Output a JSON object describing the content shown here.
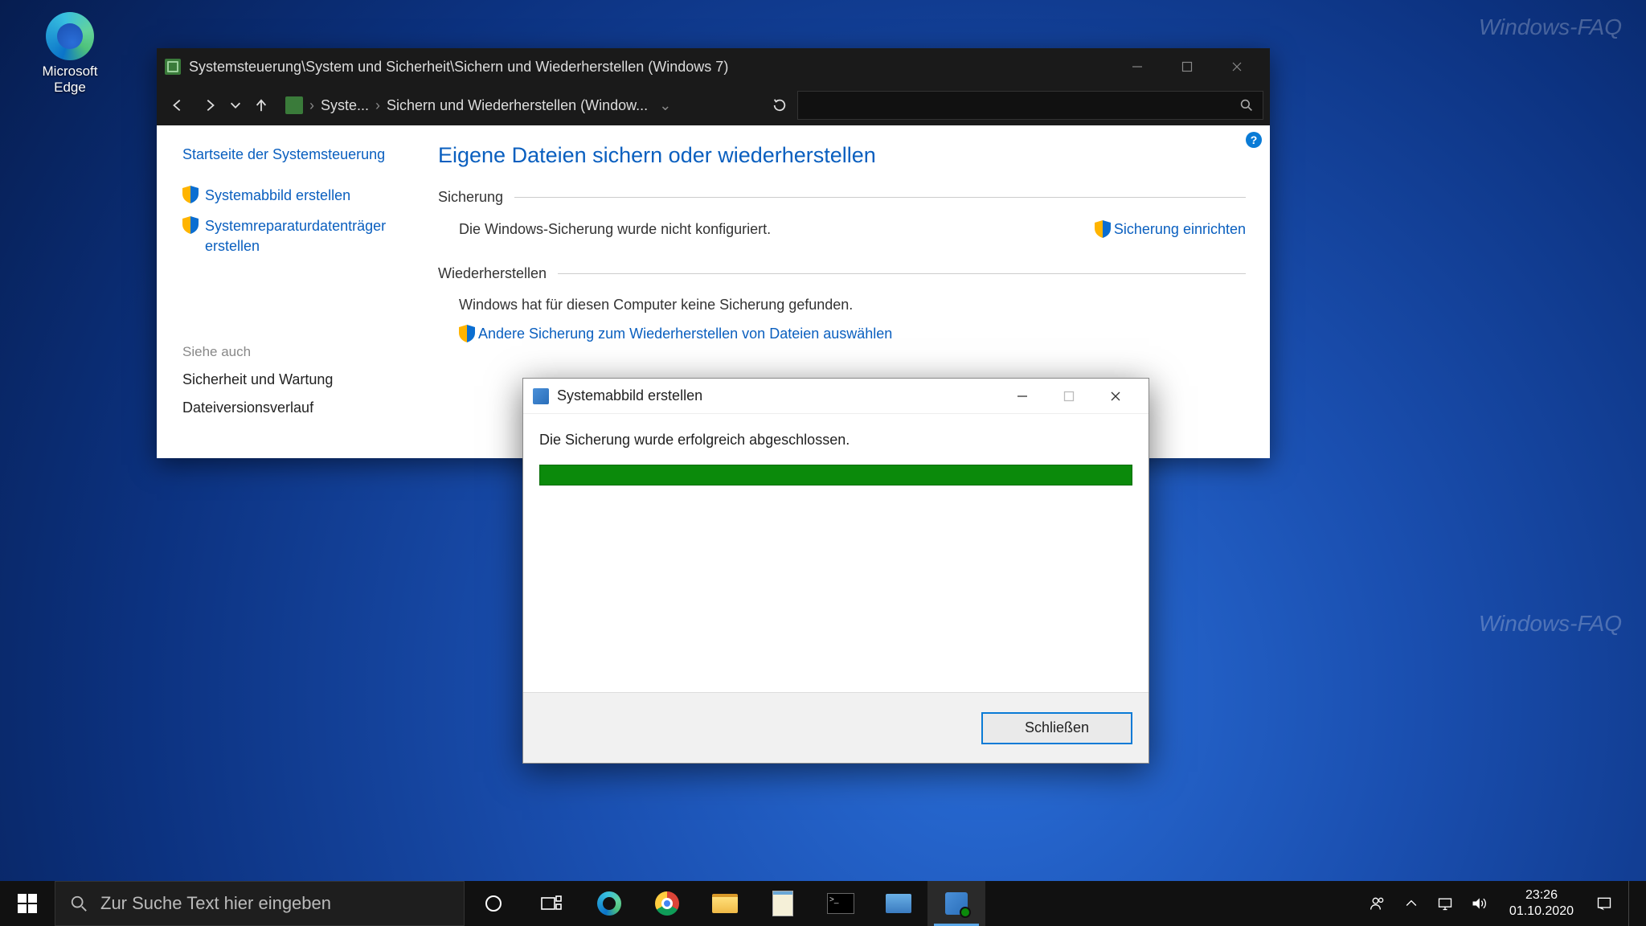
{
  "desktop": {
    "edge_label": "Microsoft Edge"
  },
  "watermark": "Windows-FAQ",
  "window": {
    "title": "Systemsteuerung\\System und Sicherheit\\Sichern und Wiederherstellen (Windows 7)",
    "breadcrumb_root": "Syste...",
    "breadcrumb_leaf": "Sichern und Wiederherstellen (Window...",
    "sidebar": {
      "home": "Startseite der Systemsteuerung",
      "link1": "Systemabbild erstellen",
      "link2": "Systemreparaturdatenträger erstellen",
      "see_also": "Siehe auch",
      "sa1": "Sicherheit und Wartung",
      "sa2": "Dateiversionsverlauf"
    },
    "main": {
      "heading": "Eigene Dateien sichern oder wiederherstellen",
      "sect_backup": "Sicherung",
      "backup_msg": "Die Windows-Sicherung wurde nicht konfiguriert.",
      "backup_setup": "Sicherung einrichten",
      "sect_restore": "Wiederherstellen",
      "restore_msg": "Windows hat für diesen Computer keine Sicherung gefunden.",
      "restore_link": "Andere Sicherung zum Wiederherstellen von Dateien auswählen"
    }
  },
  "dialog": {
    "title": "Systemabbild erstellen",
    "message": "Die Sicherung wurde erfolgreich abgeschlossen.",
    "close_btn": "Schließen"
  },
  "taskbar": {
    "search_placeholder": "Zur Suche Text hier eingeben",
    "time": "23:26",
    "date": "01.10.2020"
  }
}
